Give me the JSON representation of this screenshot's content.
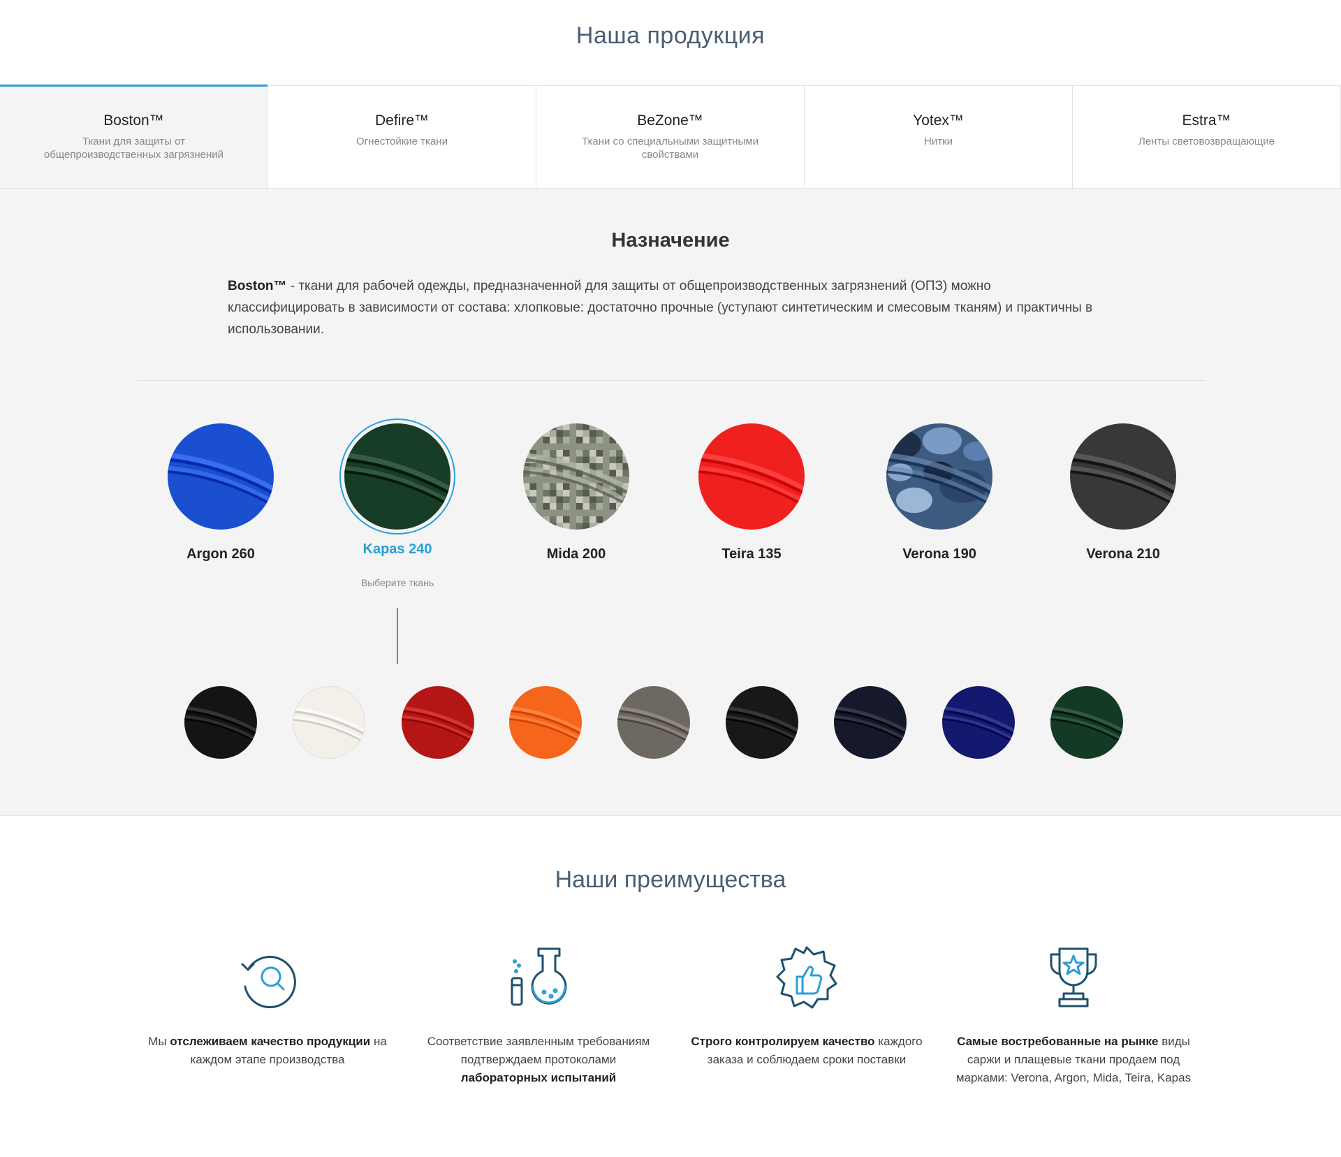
{
  "page_title": "Наша продукция",
  "tabs": [
    {
      "name": "Boston™",
      "desc": "Ткани для защиты от общепроизводственных загрязнений",
      "active": true
    },
    {
      "name": "Defire™",
      "desc": "Огнестойкие ткани",
      "active": false
    },
    {
      "name": "BeZone™",
      "desc": "Ткани со специальными защитными свойствами",
      "active": false
    },
    {
      "name": "Yotex™",
      "desc": "Нитки",
      "active": false
    },
    {
      "name": "Estra™",
      "desc": "Ленты световозвращающие",
      "active": false
    }
  ],
  "purpose": {
    "title": "Назначение",
    "brand": "Boston™",
    "text": " - ткани для рабочей одежды, предназначенной для защиты от общепроизводственных загрязнений (ОПЗ) можно классифицировать в зависимости от состава: хлопковые: достаточно прочные (уступают синтетическим и смесовым тканям) и практичны в использовании."
  },
  "fabrics": [
    {
      "name": "Argon 260",
      "color": "#1a4fd0",
      "pattern": "solid"
    },
    {
      "name": "Kapas 240",
      "color": "#173d26",
      "pattern": "solid",
      "selected": true
    },
    {
      "name": "Mida 200",
      "color": "#8a8f80",
      "pattern": "digital-camo"
    },
    {
      "name": "Teira 135",
      "color": "#f0201e",
      "pattern": "solid"
    },
    {
      "name": "Verona 190",
      "color": "#3d5a80",
      "pattern": "camo"
    },
    {
      "name": "Verona 210",
      "color": "#38383a",
      "pattern": "solid"
    }
  ],
  "fabric_hint": "Выберите ткань",
  "colors": [
    "#141414",
    "#f3efe9",
    "#b41616",
    "#f5651b",
    "#6e6862",
    "#181818",
    "#16192b",
    "#13196e",
    "#133a24"
  ],
  "advantages_title": "Наши преимущества",
  "advantages": [
    {
      "icon": "search-refresh-icon",
      "pre": "Мы ",
      "bold": "отслеживаем качество продукции",
      "post": " на каждом этапе производства"
    },
    {
      "icon": "lab-flask-icon",
      "pre": "Соответствие заявленным требованиям подтверждаем протоколами ",
      "bold": "лабораторных испытаний",
      "post": ""
    },
    {
      "icon": "thumbs-up-badge-icon",
      "pre": "",
      "bold": "Строго контролируем качество",
      "post": " каждого заказа и соблюдаем сроки поставки"
    },
    {
      "icon": "trophy-icon",
      "pre": "",
      "bold": "Самые востребованные на рынке",
      "post": " виды саржи и плащевые ткани продаем под марками: Verona, Argon, Mida, Teira, Kapas"
    }
  ],
  "accent_color": "#2a9fd6",
  "icon_color": "#1f4f6e"
}
